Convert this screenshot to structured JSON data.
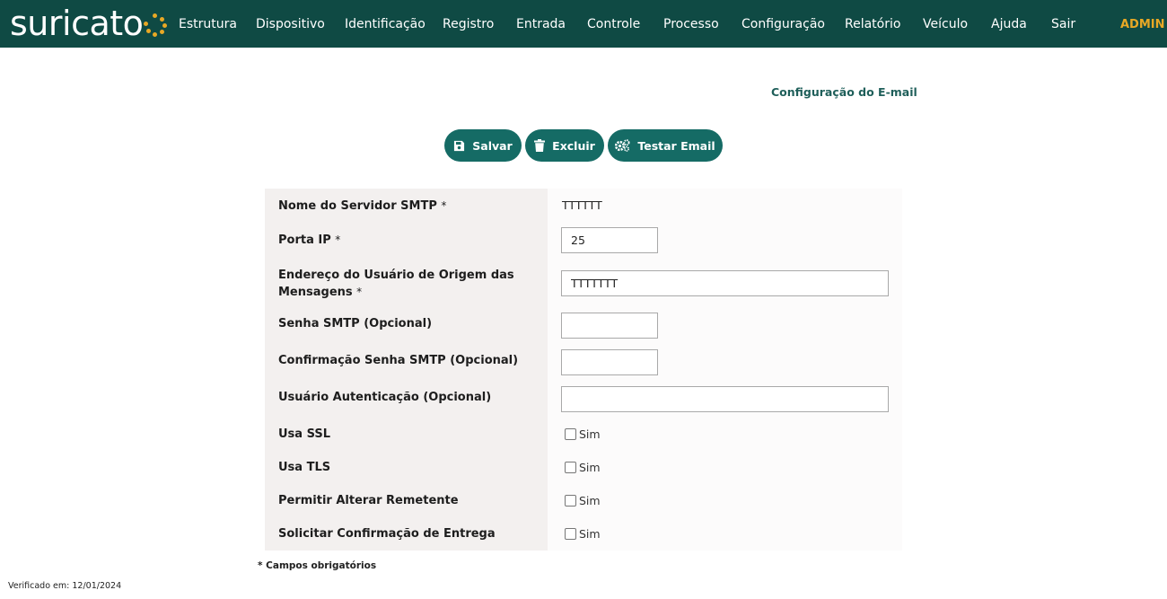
{
  "brand": {
    "name": "suricato",
    "accent": "#e8a825",
    "bar_color": "#0f4a44"
  },
  "nav": {
    "items": [
      "Estrutura",
      "Dispositivo",
      "Identificação",
      "Registro",
      "Entrada",
      "Controle",
      "Processo",
      "Configuração",
      "Relatório",
      "Veículo",
      "Ajuda",
      "Sair"
    ],
    "user": "ADMIN"
  },
  "page": {
    "title": "Configuração do E-mail"
  },
  "toolbar": {
    "save_label": "Salvar",
    "delete_label": "Excluir",
    "test_label": "Testar Email",
    "button_color": "#156b65"
  },
  "form": {
    "smtp_server": {
      "label": "Nome do Servidor SMTP",
      "required_mark": "*",
      "value": "TTTTTT"
    },
    "port": {
      "label": "Porta IP",
      "required_mark": "*",
      "value": "25"
    },
    "sender": {
      "label": "Endereço do Usuário de Origem das Mensagens",
      "label_line1": "Endereço do Usuário de Origem das",
      "label_line2": "Mensagens",
      "required_mark": "*",
      "value": "TTTTTTT"
    },
    "password": {
      "label": "Senha SMTP (Opcional)",
      "value": ""
    },
    "password_confirm": {
      "label": "Confirmação Senha SMTP (Opcional)",
      "value": ""
    },
    "auth_user": {
      "label": "Usuário Autenticação (Opcional)",
      "value": ""
    },
    "use_ssl": {
      "label": "Usa SSL",
      "option": "Sim",
      "checked": false
    },
    "use_tls": {
      "label": "Usa TLS",
      "option": "Sim",
      "checked": false
    },
    "allow_change_sender": {
      "label": "Permitir Alterar Remetente",
      "option": "Sim",
      "checked": false
    },
    "delivery_confirmation": {
      "label": "Solicitar Confirmação de Entrega",
      "option": "Sim",
      "checked": false
    }
  },
  "footer": {
    "required_note": "* Campos obrigatórios",
    "verified": "Verificado em: 12/01/2024"
  }
}
